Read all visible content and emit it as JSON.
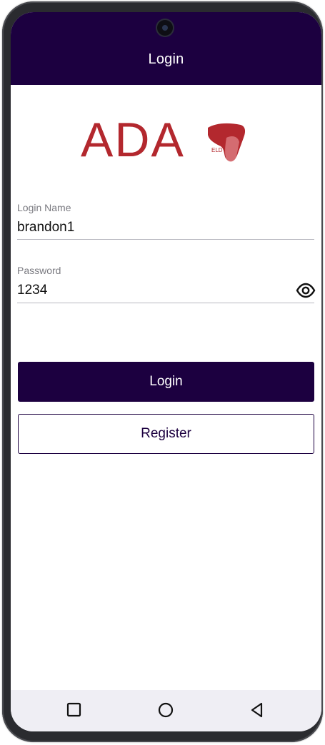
{
  "appbar": {
    "title": "Login"
  },
  "logo": {
    "text": "ADA",
    "subtext": "ELD",
    "color": "#b3282e"
  },
  "form": {
    "login_name": {
      "label": "Login Name",
      "value": "brandon1"
    },
    "password": {
      "label": "Password",
      "value": "1234",
      "toggle_icon": "eye-icon"
    }
  },
  "buttons": {
    "login_label": "Login",
    "register_label": "Register"
  },
  "navbar": {
    "items": [
      "recents-square-icon",
      "home-circle-icon",
      "back-triangle-icon"
    ]
  },
  "colors": {
    "primary": "#1c0040",
    "brand_red": "#b3282e"
  }
}
